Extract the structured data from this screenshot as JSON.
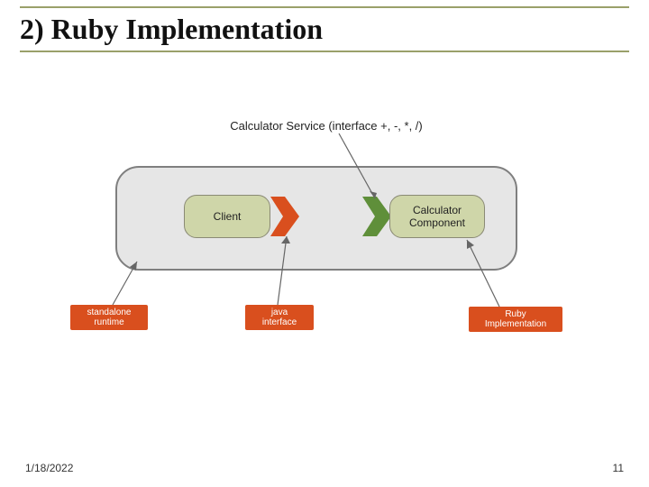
{
  "title": "2) Ruby Implementation",
  "interface_label": "Calculator Service (interface +, -, *, /)",
  "client_label": "Client",
  "component_label": "Calculator\nComponent",
  "badges": {
    "standalone": "standalone\nruntime",
    "java": "java\ninterface",
    "ruby": "Ruby\nImplementation"
  },
  "footer": {
    "date": "1/18/2022",
    "page": "11"
  },
  "colors": {
    "olive": "#cfd6a9",
    "orange": "#d94f1e",
    "rule": "#9aa06a"
  }
}
